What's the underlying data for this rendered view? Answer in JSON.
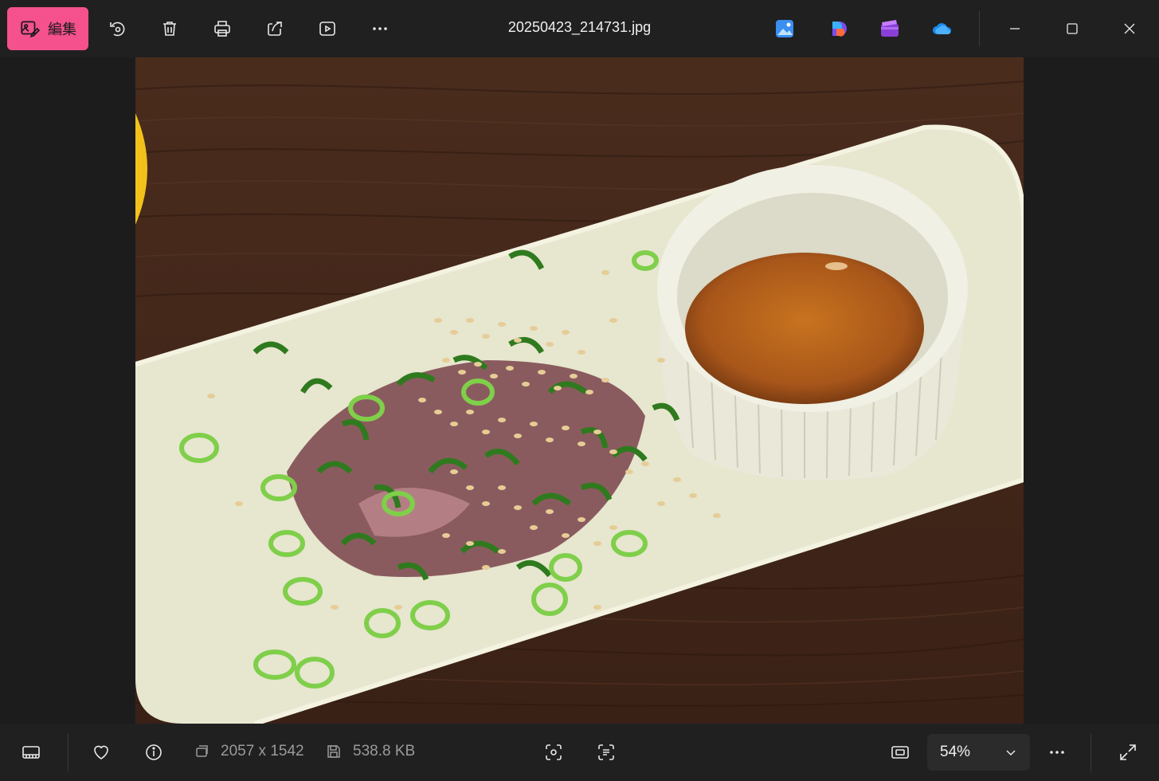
{
  "toolbar": {
    "edit_label": "編集",
    "file_name": "20250423_214731.jpg",
    "icons": [
      "rotate-icon",
      "delete-icon",
      "print-icon",
      "share-icon",
      "slideshow-icon",
      "more-icon"
    ],
    "apps": [
      "photos-app-icon",
      "copilot-app-icon",
      "clipchamp-app-icon",
      "onedrive-app-icon"
    ],
    "accent": "#f4518d"
  },
  "window_controls": [
    "minimize-icon",
    "maximize-icon",
    "close-icon"
  ],
  "status": {
    "dimensions": "2057 x 1542",
    "file_size": "538.8 KB",
    "zoom": "54%"
  }
}
